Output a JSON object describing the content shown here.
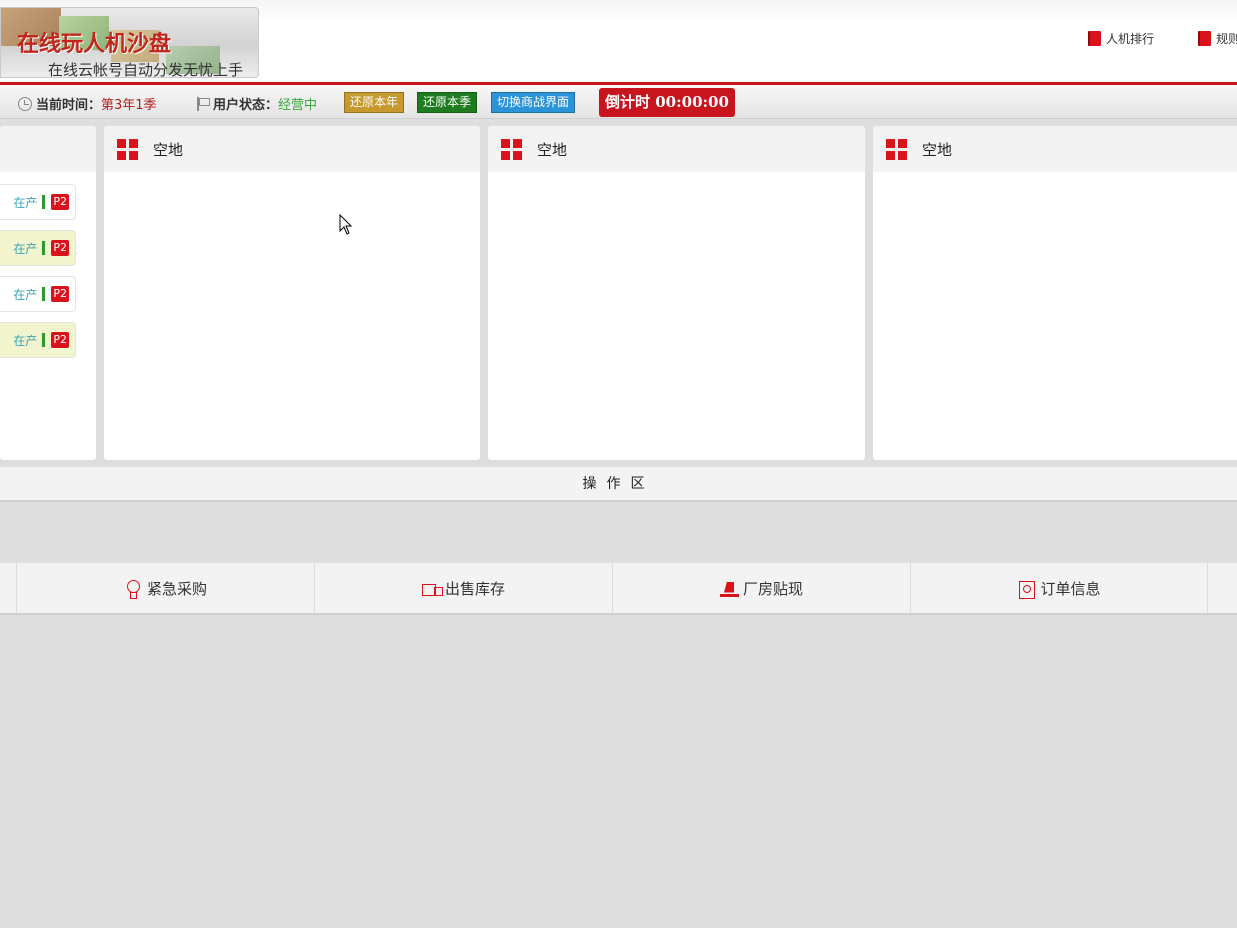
{
  "header": {
    "logo_title": "在线玩人机沙盘",
    "logo_subtitle": "在线云帐号自动分发无忧上手",
    "links": [
      {
        "label": "人机排行",
        "icon": "book-icon"
      },
      {
        "label": "规则",
        "icon": "book-icon"
      }
    ]
  },
  "status_bar": {
    "time_label": "当前时间：",
    "time_value": "第3年1季",
    "state_label": "用户状态：",
    "state_value": "经营中",
    "restore_year": "还原本年",
    "restore_season": "还原本季",
    "switch_view": "切换商战界面",
    "countdown": "倒计时 00:00:00",
    "colors": {
      "accent": "#c8141c",
      "year_btn": "#c69a2e",
      "season_btn": "#1e7c1e",
      "switch_btn": "#2b94d9"
    }
  },
  "production_lines": [
    {
      "status": "在产",
      "product": "P2"
    },
    {
      "status": "在产",
      "product": "P2"
    },
    {
      "status": "在产",
      "product": "P2"
    },
    {
      "status": "在产",
      "product": "P2"
    }
  ],
  "plots": [
    {
      "label": "空地"
    },
    {
      "label": "空地"
    },
    {
      "label": "空地"
    }
  ],
  "operation_area": {
    "label": "操作区"
  },
  "actions": [
    {
      "label": "紧急采购",
      "icon": "bulb-icon"
    },
    {
      "label": "出售库存",
      "icon": "truck-icon"
    },
    {
      "label": "厂房贴现",
      "icon": "forklift-icon"
    },
    {
      "label": "订单信息",
      "icon": "order-icon"
    }
  ]
}
